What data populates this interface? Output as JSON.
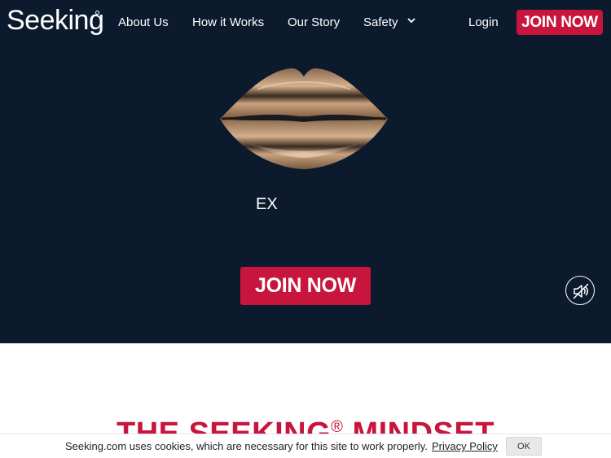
{
  "header": {
    "logo_text": "Seeking",
    "nav": {
      "about": "About Us",
      "how": "How it Works",
      "story": "Our Story",
      "safety": "Safety"
    },
    "login": "Login",
    "join": "JOIN NOW"
  },
  "hero": {
    "caption": "EX",
    "cta": "JOIN NOW",
    "sound_state": "muted"
  },
  "section": {
    "heading": "THE SEEKING",
    "heading_mark": "®",
    "heading_tail": " MINDSET"
  },
  "cookie": {
    "text": "Seeking.com uses cookies, which are necessary for this site to work properly.",
    "link": "Privacy Policy",
    "ok": "OK"
  },
  "colors": {
    "hero_bg": "#0c1a2e",
    "brand_red": "#c8153d",
    "lips_gold": "#c9a27e"
  }
}
